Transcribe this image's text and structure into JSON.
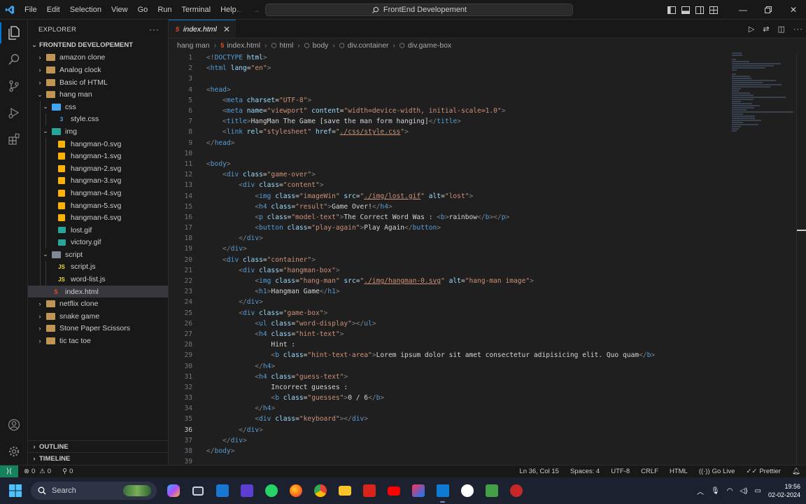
{
  "menu": [
    "File",
    "Edit",
    "Selection",
    "View",
    "Go",
    "Run",
    "Terminal",
    "Help"
  ],
  "command_center": "FrontEnd Developement",
  "explorer": {
    "title": "EXPLORER",
    "root": "FRONTEND DEVELOPEMENT",
    "items": [
      {
        "label": "amazon clone",
        "type": "folder",
        "depth": 1,
        "open": false
      },
      {
        "label": "Analog clock",
        "type": "folder",
        "depth": 1,
        "open": false
      },
      {
        "label": "Basic of HTML",
        "type": "folder",
        "depth": 1,
        "open": false
      },
      {
        "label": "hang man",
        "type": "folder",
        "depth": 1,
        "open": true
      },
      {
        "label": "css",
        "type": "folder-css",
        "depth": 2,
        "open": true
      },
      {
        "label": "style.css",
        "type": "css",
        "depth": 3
      },
      {
        "label": "img",
        "type": "folder-img",
        "depth": 2,
        "open": true
      },
      {
        "label": "hangman-0.svg",
        "type": "svg",
        "depth": 3
      },
      {
        "label": "hangman-1.svg",
        "type": "svg",
        "depth": 3
      },
      {
        "label": "hangman-2.svg",
        "type": "svg",
        "depth": 3
      },
      {
        "label": "hangman-3.svg",
        "type": "svg",
        "depth": 3
      },
      {
        "label": "hangman-4.svg",
        "type": "svg",
        "depth": 3
      },
      {
        "label": "hangman-5.svg",
        "type": "svg",
        "depth": 3
      },
      {
        "label": "hangman-6.svg",
        "type": "svg",
        "depth": 3
      },
      {
        "label": "lost.gif",
        "type": "gif",
        "depth": 3
      },
      {
        "label": "victory.gif",
        "type": "gif",
        "depth": 3
      },
      {
        "label": "script",
        "type": "folder-script",
        "depth": 2,
        "open": true
      },
      {
        "label": "script.js",
        "type": "js",
        "depth": 3
      },
      {
        "label": "word-list.js",
        "type": "js",
        "depth": 3
      },
      {
        "label": "index.html",
        "type": "html",
        "depth": 2,
        "selected": true
      },
      {
        "label": "netflix clone",
        "type": "folder",
        "depth": 1,
        "open": false
      },
      {
        "label": "snake game",
        "type": "folder",
        "depth": 1,
        "open": false
      },
      {
        "label": "Stone Paper Scissors",
        "type": "folder",
        "depth": 1,
        "open": false
      },
      {
        "label": "tic tac toe",
        "type": "folder",
        "depth": 1,
        "open": false
      }
    ],
    "outline": "OUTLINE",
    "timeline": "TIMELINE"
  },
  "tab": {
    "label": "index.html"
  },
  "breadcrumb": [
    "hang man",
    "index.html",
    "html",
    "body",
    "div.container",
    "div.game-box"
  ],
  "current_line": 36,
  "code_lines": [
    [
      [
        "t",
        "<!"
      ],
      [
        "tg",
        "DOCTYPE"
      ],
      [
        "at",
        " html"
      ],
      [
        "t",
        ">"
      ]
    ],
    [
      [
        "t",
        "<"
      ],
      [
        "tg",
        "html"
      ],
      [
        "at",
        " lang"
      ],
      [
        "tx",
        "="
      ],
      [
        "st",
        "\"en\""
      ],
      [
        "t",
        ">"
      ]
    ],
    [],
    [
      [
        "t",
        "<"
      ],
      [
        "tg",
        "head"
      ],
      [
        "t",
        ">"
      ]
    ],
    [
      [
        "tx",
        "    "
      ],
      [
        "t",
        "<"
      ],
      [
        "tg",
        "meta"
      ],
      [
        "at",
        " charset"
      ],
      [
        "tx",
        "="
      ],
      [
        "st",
        "\"UTF-8\""
      ],
      [
        "t",
        ">"
      ]
    ],
    [
      [
        "tx",
        "    "
      ],
      [
        "t",
        "<"
      ],
      [
        "tg",
        "meta"
      ],
      [
        "at",
        " name"
      ],
      [
        "tx",
        "="
      ],
      [
        "st",
        "\"viewport\""
      ],
      [
        "at",
        " content"
      ],
      [
        "tx",
        "="
      ],
      [
        "st",
        "\"width=device-width, initial-scale=1.0\""
      ],
      [
        "t",
        ">"
      ]
    ],
    [
      [
        "tx",
        "    "
      ],
      [
        "t",
        "<"
      ],
      [
        "tg",
        "title"
      ],
      [
        "t",
        ">"
      ],
      [
        "tx",
        "HangMan The Game [save the man form hanging]"
      ],
      [
        "t",
        "</"
      ],
      [
        "tg",
        "title"
      ],
      [
        "t",
        ">"
      ]
    ],
    [
      [
        "tx",
        "    "
      ],
      [
        "t",
        "<"
      ],
      [
        "tg",
        "link"
      ],
      [
        "at",
        " rel"
      ],
      [
        "tx",
        "="
      ],
      [
        "st",
        "\"stylesheet\""
      ],
      [
        "at",
        " href"
      ],
      [
        "tx",
        "="
      ],
      [
        "st",
        "\""
      ],
      [
        "lk",
        "./css/style.css"
      ],
      [
        "st",
        "\""
      ],
      [
        "t",
        ">"
      ]
    ],
    [
      [
        "t",
        "</"
      ],
      [
        "tg",
        "head"
      ],
      [
        "t",
        ">"
      ]
    ],
    [],
    [
      [
        "t",
        "<"
      ],
      [
        "tg",
        "body"
      ],
      [
        "t",
        ">"
      ]
    ],
    [
      [
        "tx",
        "    "
      ],
      [
        "t",
        "<"
      ],
      [
        "tg",
        "div"
      ],
      [
        "at",
        " class"
      ],
      [
        "tx",
        "="
      ],
      [
        "st",
        "\"game-over\""
      ],
      [
        "t",
        ">"
      ]
    ],
    [
      [
        "tx",
        "        "
      ],
      [
        "t",
        "<"
      ],
      [
        "tg",
        "div"
      ],
      [
        "at",
        " class"
      ],
      [
        "tx",
        "="
      ],
      [
        "st",
        "\"content\""
      ],
      [
        "t",
        ">"
      ]
    ],
    [
      [
        "tx",
        "            "
      ],
      [
        "t",
        "<"
      ],
      [
        "tg",
        "img"
      ],
      [
        "at",
        " class"
      ],
      [
        "tx",
        "="
      ],
      [
        "st",
        "\"imageWin\""
      ],
      [
        "at",
        " src"
      ],
      [
        "tx",
        "="
      ],
      [
        "st",
        "\""
      ],
      [
        "lk",
        "./img/lost.gif"
      ],
      [
        "st",
        "\""
      ],
      [
        "at",
        " alt"
      ],
      [
        "tx",
        "="
      ],
      [
        "st",
        "\"lost\""
      ],
      [
        "t",
        ">"
      ]
    ],
    [
      [
        "tx",
        "            "
      ],
      [
        "t",
        "<"
      ],
      [
        "tg",
        "h4"
      ],
      [
        "at",
        " class"
      ],
      [
        "tx",
        "="
      ],
      [
        "st",
        "\"result\""
      ],
      [
        "t",
        ">"
      ],
      [
        "tx",
        "Game Over!"
      ],
      [
        "t",
        "</"
      ],
      [
        "tg",
        "h4"
      ],
      [
        "t",
        ">"
      ]
    ],
    [
      [
        "tx",
        "            "
      ],
      [
        "t",
        "<"
      ],
      [
        "tg",
        "p"
      ],
      [
        "at",
        " class"
      ],
      [
        "tx",
        "="
      ],
      [
        "st",
        "\"model-text\""
      ],
      [
        "t",
        ">"
      ],
      [
        "tx",
        "The Correct Word Was : "
      ],
      [
        "t",
        "<"
      ],
      [
        "tg",
        "b"
      ],
      [
        "t",
        ">"
      ],
      [
        "tx",
        "rainbow"
      ],
      [
        "t",
        "</"
      ],
      [
        "tg",
        "b"
      ],
      [
        "t",
        "></"
      ],
      [
        "tg",
        "p"
      ],
      [
        "t",
        ">"
      ]
    ],
    [
      [
        "tx",
        "            "
      ],
      [
        "t",
        "<"
      ],
      [
        "tg",
        "button"
      ],
      [
        "at",
        " class"
      ],
      [
        "tx",
        "="
      ],
      [
        "st",
        "\"play-again\""
      ],
      [
        "t",
        ">"
      ],
      [
        "tx",
        "Play Again"
      ],
      [
        "t",
        "</"
      ],
      [
        "tg",
        "button"
      ],
      [
        "t",
        ">"
      ]
    ],
    [
      [
        "tx",
        "        "
      ],
      [
        "t",
        "</"
      ],
      [
        "tg",
        "div"
      ],
      [
        "t",
        ">"
      ]
    ],
    [
      [
        "tx",
        "    "
      ],
      [
        "t",
        "</"
      ],
      [
        "tg",
        "div"
      ],
      [
        "t",
        ">"
      ]
    ],
    [
      [
        "tx",
        "    "
      ],
      [
        "t",
        "<"
      ],
      [
        "tg",
        "div"
      ],
      [
        "at",
        " class"
      ],
      [
        "tx",
        "="
      ],
      [
        "st",
        "\"container\""
      ],
      [
        "t",
        ">"
      ]
    ],
    [
      [
        "tx",
        "        "
      ],
      [
        "t",
        "<"
      ],
      [
        "tg",
        "div"
      ],
      [
        "at",
        " class"
      ],
      [
        "tx",
        "="
      ],
      [
        "st",
        "\"hangman-box\""
      ],
      [
        "t",
        ">"
      ]
    ],
    [
      [
        "tx",
        "            "
      ],
      [
        "t",
        "<"
      ],
      [
        "tg",
        "img"
      ],
      [
        "at",
        " class"
      ],
      [
        "tx",
        "="
      ],
      [
        "st",
        "\"hang-man\""
      ],
      [
        "at",
        " src"
      ],
      [
        "tx",
        "="
      ],
      [
        "st",
        "\""
      ],
      [
        "lk",
        "./img/hangman-0.svg"
      ],
      [
        "st",
        "\""
      ],
      [
        "at",
        " alt"
      ],
      [
        "tx",
        "="
      ],
      [
        "st",
        "\"hang-man image\""
      ],
      [
        "t",
        ">"
      ]
    ],
    [
      [
        "tx",
        "            "
      ],
      [
        "t",
        "<"
      ],
      [
        "tg",
        "h1"
      ],
      [
        "t",
        ">"
      ],
      [
        "tx",
        "Hangman Game"
      ],
      [
        "t",
        "</"
      ],
      [
        "tg",
        "h1"
      ],
      [
        "t",
        ">"
      ]
    ],
    [
      [
        "tx",
        "        "
      ],
      [
        "t",
        "</"
      ],
      [
        "tg",
        "div"
      ],
      [
        "t",
        ">"
      ]
    ],
    [
      [
        "tx",
        "        "
      ],
      [
        "t",
        "<"
      ],
      [
        "tg",
        "div"
      ],
      [
        "at",
        " class"
      ],
      [
        "tx",
        "="
      ],
      [
        "st",
        "\"game-box\""
      ],
      [
        "t",
        ">"
      ]
    ],
    [
      [
        "tx",
        "            "
      ],
      [
        "t",
        "<"
      ],
      [
        "tg",
        "ul"
      ],
      [
        "at",
        " class"
      ],
      [
        "tx",
        "="
      ],
      [
        "st",
        "\"word-display\""
      ],
      [
        "t",
        "></"
      ],
      [
        "tg",
        "ul"
      ],
      [
        "t",
        ">"
      ]
    ],
    [
      [
        "tx",
        "            "
      ],
      [
        "t",
        "<"
      ],
      [
        "tg",
        "h4"
      ],
      [
        "at",
        " class"
      ],
      [
        "tx",
        "="
      ],
      [
        "st",
        "\"hint-text\""
      ],
      [
        "t",
        ">"
      ]
    ],
    [
      [
        "tx",
        "                Hint :"
      ]
    ],
    [
      [
        "tx",
        "                "
      ],
      [
        "t",
        "<"
      ],
      [
        "tg",
        "b"
      ],
      [
        "at",
        " class"
      ],
      [
        "tx",
        "="
      ],
      [
        "st",
        "\"hint-text-area\""
      ],
      [
        "t",
        ">"
      ],
      [
        "tx",
        "Lorem ipsum dolor sit amet consectetur adipisicing elit. Quo quam"
      ],
      [
        "t",
        "</"
      ],
      [
        "tg",
        "b"
      ],
      [
        "t",
        ">"
      ]
    ],
    [
      [
        "tx",
        "            "
      ],
      [
        "t",
        "</"
      ],
      [
        "tg",
        "h4"
      ],
      [
        "t",
        ">"
      ]
    ],
    [
      [
        "tx",
        "            "
      ],
      [
        "t",
        "<"
      ],
      [
        "tg",
        "h4"
      ],
      [
        "at",
        " class"
      ],
      [
        "tx",
        "="
      ],
      [
        "st",
        "\"guess-text\""
      ],
      [
        "t",
        ">"
      ]
    ],
    [
      [
        "tx",
        "                Incorrect guesses :"
      ]
    ],
    [
      [
        "tx",
        "                "
      ],
      [
        "t",
        "<"
      ],
      [
        "tg",
        "b"
      ],
      [
        "at",
        " class"
      ],
      [
        "tx",
        "="
      ],
      [
        "st",
        "\"guesses\""
      ],
      [
        "t",
        ">"
      ],
      [
        "tx",
        "0 / 6"
      ],
      [
        "t",
        "</"
      ],
      [
        "tg",
        "b"
      ],
      [
        "t",
        ">"
      ]
    ],
    [
      [
        "tx",
        "            "
      ],
      [
        "t",
        "</"
      ],
      [
        "tg",
        "h4"
      ],
      [
        "t",
        ">"
      ]
    ],
    [
      [
        "tx",
        "            "
      ],
      [
        "t",
        "<"
      ],
      [
        "tg",
        "div"
      ],
      [
        "at",
        " class"
      ],
      [
        "tx",
        "="
      ],
      [
        "st",
        "\"keyboard\""
      ],
      [
        "t",
        "></"
      ],
      [
        "tg",
        "div"
      ],
      [
        "t",
        ">"
      ]
    ],
    [
      [
        "tx",
        "        "
      ],
      [
        "t",
        "</"
      ],
      [
        "tg",
        "div"
      ],
      [
        "t",
        ">"
      ]
    ],
    [
      [
        "tx",
        "    "
      ],
      [
        "t",
        "</"
      ],
      [
        "tg",
        "div"
      ],
      [
        "t",
        ">"
      ]
    ],
    [
      [
        "t",
        "</"
      ],
      [
        "tg",
        "body"
      ],
      [
        "t",
        ">"
      ]
    ],
    []
  ],
  "status": {
    "errors": "0",
    "warnings": "0",
    "ports": "0",
    "position": "Ln 36, Col 15",
    "spaces": "Spaces: 4",
    "encoding": "UTF-8",
    "eol": "CRLF",
    "language": "HTML",
    "golive": "Go Live",
    "prettier": "Prettier"
  },
  "taskbar": {
    "search_placeholder": "Search",
    "time": "19:56",
    "date": "02-02-2024"
  },
  "colors": {
    "accent": "#0078d4",
    "remote": "#16825d",
    "tag": "#569cd6",
    "attr": "#9cdcfe",
    "string": "#ce9178"
  }
}
